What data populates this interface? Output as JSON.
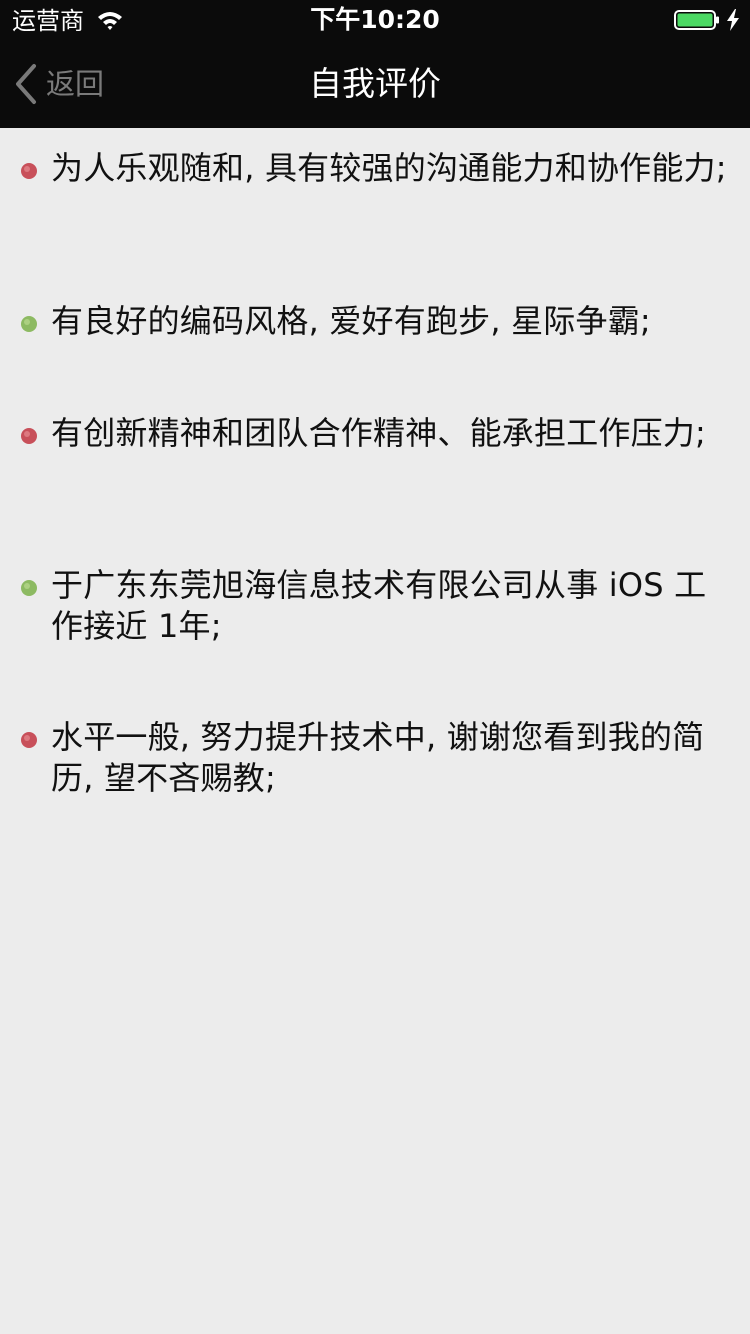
{
  "status_bar": {
    "carrier": "运营商",
    "time": "下午10:20"
  },
  "nav": {
    "back_label": "返回",
    "title": "自我评价"
  },
  "evaluation_items": [
    {
      "text": "为人乐观随和, 具有较强的沟通能力和协作能力;",
      "bullet": "red"
    },
    {
      "text": "有良好的编码风格, 爱好有跑步, 星际争霸;",
      "bullet": "green"
    },
    {
      "text": "有创新精神和团队合作精神、能承担工作压力;",
      "bullet": "red"
    },
    {
      "text": "于广东东莞旭海信息技术有限公司从事 iOS 工作接近 1年;",
      "bullet": "green"
    },
    {
      "text": "水平一般, 努力提升技术中, 谢谢您看到我的简历, 望不吝赐教;",
      "bullet": "red"
    }
  ],
  "colors": {
    "nav_background": "#0B0B0B",
    "page_background": "#ECECEC",
    "bullet_red": "#C8505A",
    "bullet_green": "#8DBA62",
    "battery_green": "#4CD964"
  }
}
